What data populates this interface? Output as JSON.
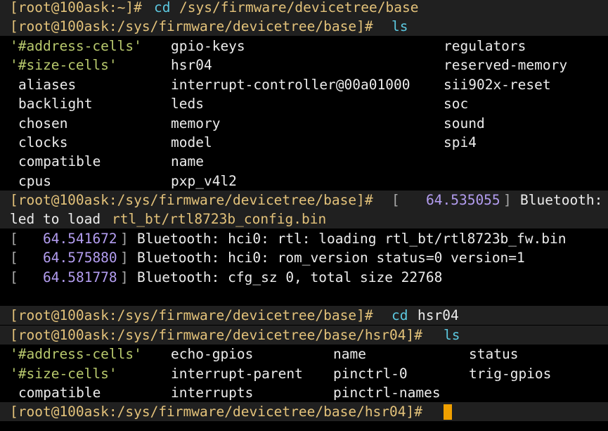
{
  "colors": {
    "background": "#000000",
    "highlight_band": "#202020",
    "prompt_bracket": "#a8a8a8",
    "prompt_path": "#e3c27a",
    "command": "#5cc8e0",
    "quoted_name": "#b8c96d",
    "number": "#b39df0",
    "cursor": "#f0a000"
  },
  "terminal": {
    "line1": {
      "prompt": "[root@100ask:~]#",
      "cmd": "cd",
      "arg": "/sys/firmware/devicetree/base"
    },
    "line2": {
      "prompt": "[root@100ask:/sys/firmware/devicetree/base]#",
      "cmd": "ls"
    },
    "ls1": {
      "col1": [
        "'#address-cells'",
        "'#size-cells'",
        "aliases",
        "backlight",
        "chosen",
        "clocks",
        "compatible",
        "cpus"
      ],
      "col2": [
        "gpio-keys",
        "hsr04",
        "interrupt-controller@00a01000",
        "leds",
        "memory",
        "model",
        "name",
        "pxp_v4l2"
      ],
      "col3": [
        "regulators",
        "reserved-memory",
        "sii902x-reset",
        "soc",
        "sound",
        "spi4"
      ]
    },
    "kmsg_line": {
      "prompt": "[root@100ask:/sys/firmware/devicetree/base]#",
      "open_bracket": "[",
      "timestamp": "64.535055",
      "close_bracket": "]",
      "text": "Bluetooth:"
    },
    "kmsg_wrap": {
      "text1": "led to load",
      "file": "rtl_bt/rtl8723b_config.bin"
    },
    "kmsg": [
      {
        "timestamp": "64.541672",
        "text": "Bluetooth: hci0: rtl: loading rtl_bt/rtl8723b_fw.bin"
      },
      {
        "timestamp": "64.575880",
        "text": "Bluetooth: hci0: rom_version status=0 version=1"
      },
      {
        "timestamp": "64.581778",
        "text": "Bluetooth: cfg_sz 0, total size 22768"
      }
    ],
    "line_cd": {
      "prompt": "[root@100ask:/sys/firmware/devicetree/base]#",
      "cmd": "cd",
      "arg": "hsr04"
    },
    "line_ls": {
      "prompt": "[root@100ask:/sys/firmware/devicetree/base/hsr04]#",
      "cmd": "ls"
    },
    "ls2": {
      "col1": [
        "'#address-cells'",
        "'#size-cells'",
        "compatible"
      ],
      "col2": [
        "echo-gpios",
        "interrupt-parent",
        "interrupts"
      ],
      "col3": [
        "name",
        "pinctrl-0",
        "pinctrl-names"
      ],
      "col4": [
        "status",
        "trig-gpios"
      ]
    },
    "final_prompt": "[root@100ask:/sys/firmware/devicetree/base/hsr04]#"
  }
}
